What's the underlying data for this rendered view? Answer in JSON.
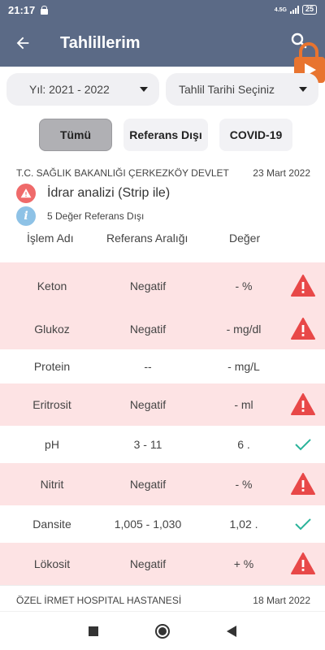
{
  "status_bar": {
    "time": "21:17",
    "network": "4.5G",
    "battery": "25"
  },
  "app_bar": {
    "title": "Tahlillerim",
    "back_icon": "arrow-left-icon",
    "search_icon": "search-icon"
  },
  "filters": {
    "year": "Yıl: 2021 - 2022",
    "date": "Tahlil Tarihi Seçiniz"
  },
  "segments": {
    "all": "Tümü",
    "out_of_range": "Referans Dışı",
    "covid": "COVID-19"
  },
  "groups": [
    {
      "institution": "T.C. SAĞLIK BAKANLIĞI ÇERKEZKÖY DEVLET",
      "date": "23 Mart 2022",
      "test_name": "İdrar analizi (Strip ile)",
      "summary": "5 Değer Referans Dışı"
    },
    {
      "institution": "ÖZEL İRMET HOSPITAL HASTANESİ",
      "date": "18 Mart 2022"
    }
  ],
  "table": {
    "headers": {
      "name": "İşlem Adı",
      "range": "Referans Aralığı",
      "value": "Değer"
    },
    "rows": [
      {
        "name": "Keton",
        "range": "Negatif",
        "value": "- %",
        "status": "warning"
      },
      {
        "name": "Glukoz",
        "range": "Negatif",
        "value": "- mg/dl",
        "status": "warning"
      },
      {
        "name": "Protein",
        "range": "--",
        "value": "- mg/L",
        "status": "none"
      },
      {
        "name": "Eritrosit",
        "range": "Negatif",
        "value": "- ml",
        "status": "warning"
      },
      {
        "name": "pH",
        "range": "3 - 11",
        "value": "6 .",
        "status": "ok"
      },
      {
        "name": "Nitrit",
        "range": "Negatif",
        "value": "- %",
        "status": "warning"
      },
      {
        "name": "Dansite",
        "range": "1,005 - 1,030",
        "value": "1,02 .",
        "status": "ok"
      },
      {
        "name": "Lökosit",
        "range": "Negatif",
        "value": "+ %",
        "status": "warning"
      }
    ]
  },
  "colors": {
    "header": "#5b6a86",
    "alert_row": "#fde3e4",
    "warning": "#e84848",
    "ok": "#2ab39a"
  }
}
